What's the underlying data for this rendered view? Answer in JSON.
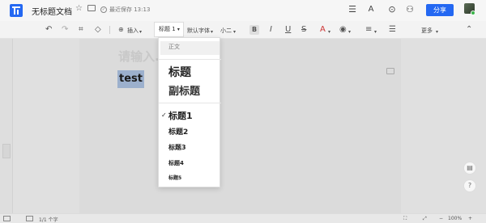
{
  "app": {
    "doc_title": "无标题文档",
    "saved_status": "最近保存 13:13",
    "share_label": "分享"
  },
  "toolbar": {
    "insert_label": "插入",
    "heading_label": "标题 1",
    "font_label": "默认字体",
    "size_label": "小二",
    "more_label": "更多"
  },
  "document": {
    "placeholder": "请输入...",
    "text": "test"
  },
  "heading_menu": {
    "items": [
      {
        "label": "正文",
        "size": 7
      },
      {
        "label": "标题",
        "size": 14
      },
      {
        "label": "副标题",
        "size": 13
      },
      {
        "label": "标题1",
        "size": 11,
        "checked": true
      },
      {
        "label": "标题2",
        "size": 9
      },
      {
        "label": "标题3",
        "size": 8
      },
      {
        "label": "标题4",
        "size": 7
      },
      {
        "label": "标题5",
        "size": 6
      }
    ]
  },
  "statusbar": {
    "page_info": "1/1 个字",
    "zoom": "100%"
  },
  "colors": {
    "accent": "#2468f2",
    "selection": "#9cb0cd"
  }
}
